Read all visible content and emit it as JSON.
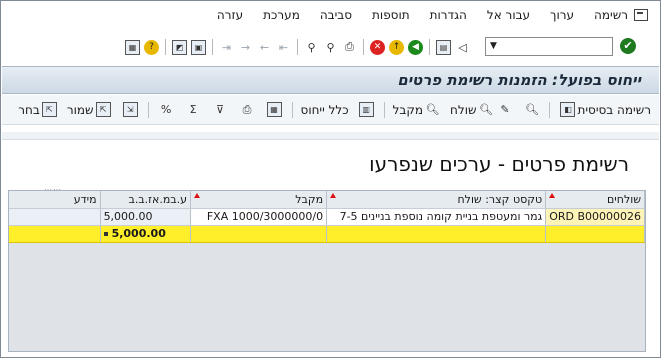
{
  "menu": {
    "items": [
      "רשימה",
      "ערוך",
      "עבור אל",
      "הגדרות",
      "תוספות",
      "סביבה",
      "מערכת",
      "עזרה"
    ]
  },
  "toolbar": {
    "command_field_value": ""
  },
  "title": "ייחוס בפועל: הזמנות רשימת פרטים",
  "app_toolbar": {
    "basic_list": "רשימה בסיסית",
    "sender": "שולח",
    "receiver": "מקבל",
    "total_allocation": "כלל ייחוס",
    "save": "שמור",
    "choose": "בחר"
  },
  "list_title": "רשימת פרטים - ערכים שנפרעו",
  "grid": {
    "columns": [
      "שולחים",
      "טקסט קצר: שולח",
      "מקבל",
      "ע.במ.אז.ב.ב",
      "מידע"
    ],
    "rows": [
      [
        "ORD B00000026",
        "גמר ומעטפת בניית קומה נוספת בניינים 7-5",
        "FXA 1000/3000000/0",
        "5,000.00",
        ""
      ]
    ],
    "total": "5,000.00"
  }
}
